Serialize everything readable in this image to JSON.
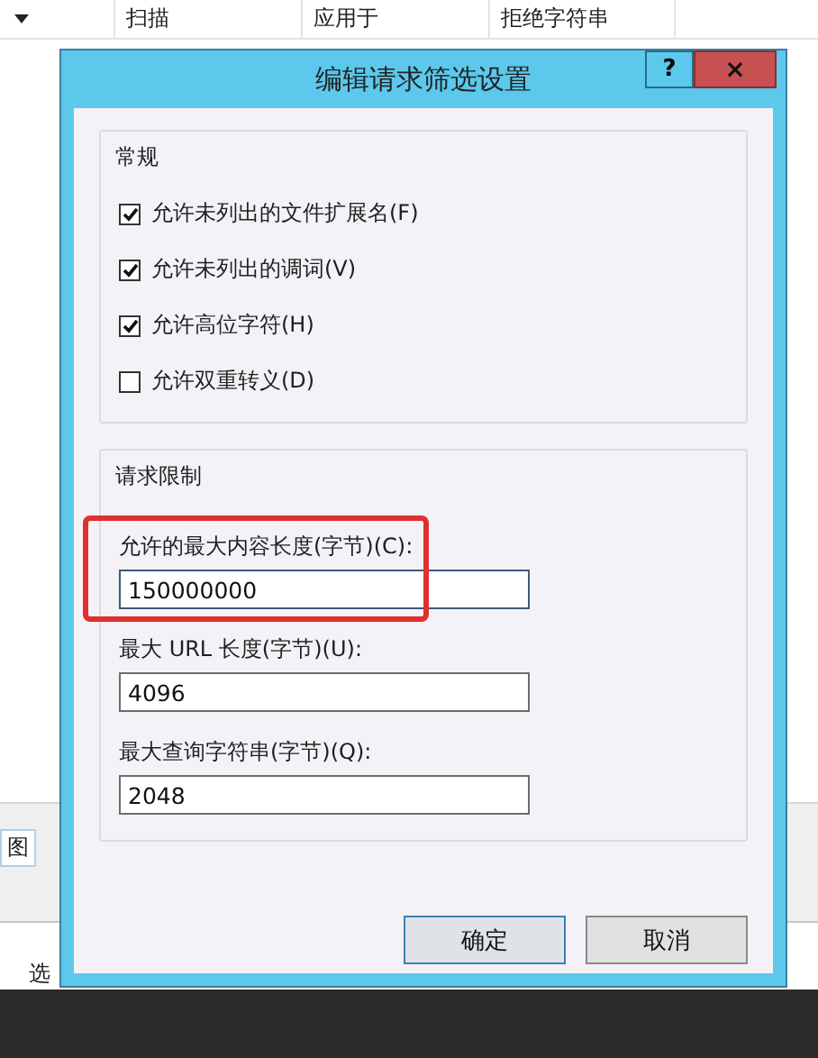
{
  "background": {
    "columns": [
      "扫描",
      "应用于",
      "拒绝字符串"
    ],
    "side_texts": [
      "图",
      "选"
    ]
  },
  "dialog": {
    "title": "编辑请求筛选设置",
    "help": "?",
    "close": "×",
    "general": {
      "title": "常规",
      "options": [
        {
          "label": "允许未列出的文件扩展名(F)",
          "checked": true
        },
        {
          "label": "允许未列出的调词(V)",
          "checked": true
        },
        {
          "label": "允许高位字符(H)",
          "checked": true
        },
        {
          "label": "允许双重转义(D)",
          "checked": false
        }
      ]
    },
    "limits": {
      "title": "请求限制",
      "fields": [
        {
          "label": "允许的最大内容长度(字节)(C):",
          "value": "150000000",
          "focused": true,
          "highlighted": true
        },
        {
          "label": "最大 URL 长度(字节)(U):",
          "value": "4096",
          "focused": false,
          "highlighted": false
        },
        {
          "label": "最大查询字符串(字节)(Q):",
          "value": "2048",
          "focused": false,
          "highlighted": false
        }
      ]
    },
    "buttons": [
      {
        "label": "确定",
        "default": true
      },
      {
        "label": "取消",
        "default": false
      }
    ]
  }
}
